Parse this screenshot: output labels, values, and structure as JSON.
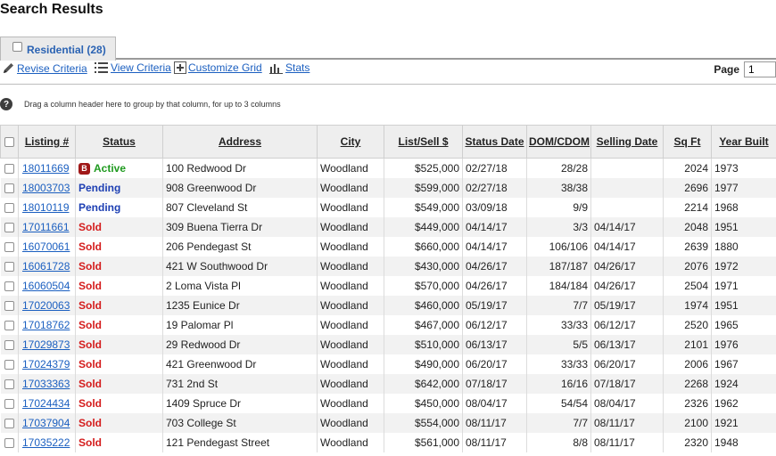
{
  "page": {
    "title": "Search Results"
  },
  "tab": {
    "label": "Residential (28)"
  },
  "toolbar": {
    "revise_label": "Revise Criteria",
    "view_label": "View Criteria",
    "customize_label": "Customize Grid",
    "stats_label": "Stats",
    "page_label": "Page",
    "page_value": "1"
  },
  "hint": {
    "text": "Drag a column header here to group by that column, for up to 3 columns"
  },
  "columns": [
    "Listing #",
    "Status",
    "Address",
    "City",
    "List/Sell $",
    "Status Date",
    "DOM/CDOM",
    "Selling Date",
    "Sq Ft",
    "Year Built"
  ],
  "rows": [
    {
      "listing": "18011669",
      "status": "Active",
      "badge": "B",
      "address": "100 Redwood Dr",
      "city": "Woodland",
      "price": "$525,000",
      "status_date": "02/27/18",
      "dom": "28/28",
      "selling_date": "",
      "sqft": "2024",
      "year": "1973"
    },
    {
      "listing": "18003703",
      "status": "Pending",
      "badge": "",
      "address": "908 Greenwood Dr",
      "city": "Woodland",
      "price": "$599,000",
      "status_date": "02/27/18",
      "dom": "38/38",
      "selling_date": "",
      "sqft": "2696",
      "year": "1977"
    },
    {
      "listing": "18010119",
      "status": "Pending",
      "badge": "",
      "address": "807 Cleveland St",
      "city": "Woodland",
      "price": "$549,000",
      "status_date": "03/09/18",
      "dom": "9/9",
      "selling_date": "",
      "sqft": "2214",
      "year": "1968"
    },
    {
      "listing": "17011661",
      "status": "Sold",
      "badge": "",
      "address": "309 Buena Tierra Dr",
      "city": "Woodland",
      "price": "$449,000",
      "status_date": "04/14/17",
      "dom": "3/3",
      "selling_date": "04/14/17",
      "sqft": "2048",
      "year": "1951"
    },
    {
      "listing": "16070061",
      "status": "Sold",
      "badge": "",
      "address": "206 Pendegast St",
      "city": "Woodland",
      "price": "$660,000",
      "status_date": "04/14/17",
      "dom": "106/106",
      "selling_date": "04/14/17",
      "sqft": "2639",
      "year": "1880"
    },
    {
      "listing": "16061728",
      "status": "Sold",
      "badge": "",
      "address": "421 W Southwood Dr",
      "city": "Woodland",
      "price": "$430,000",
      "status_date": "04/26/17",
      "dom": "187/187",
      "selling_date": "04/26/17",
      "sqft": "2076",
      "year": "1972"
    },
    {
      "listing": "16060504",
      "status": "Sold",
      "badge": "",
      "address": "2 Loma Vista Pl",
      "city": "Woodland",
      "price": "$570,000",
      "status_date": "04/26/17",
      "dom": "184/184",
      "selling_date": "04/26/17",
      "sqft": "2504",
      "year": "1971"
    },
    {
      "listing": "17020063",
      "status": "Sold",
      "badge": "",
      "address": "1235 Eunice Dr",
      "city": "Woodland",
      "price": "$460,000",
      "status_date": "05/19/17",
      "dom": "7/7",
      "selling_date": "05/19/17",
      "sqft": "1974",
      "year": "1951"
    },
    {
      "listing": "17018762",
      "status": "Sold",
      "badge": "",
      "address": "19 Palomar Pl",
      "city": "Woodland",
      "price": "$467,000",
      "status_date": "06/12/17",
      "dom": "33/33",
      "selling_date": "06/12/17",
      "sqft": "2520",
      "year": "1965"
    },
    {
      "listing": "17029873",
      "status": "Sold",
      "badge": "",
      "address": "29 Redwood Dr",
      "city": "Woodland",
      "price": "$510,000",
      "status_date": "06/13/17",
      "dom": "5/5",
      "selling_date": "06/13/17",
      "sqft": "2101",
      "year": "1976"
    },
    {
      "listing": "17024379",
      "status": "Sold",
      "badge": "",
      "address": "421 Greenwood Dr",
      "city": "Woodland",
      "price": "$490,000",
      "status_date": "06/20/17",
      "dom": "33/33",
      "selling_date": "06/20/17",
      "sqft": "2006",
      "year": "1967"
    },
    {
      "listing": "17033363",
      "status": "Sold",
      "badge": "",
      "address": "731 2nd St",
      "city": "Woodland",
      "price": "$642,000",
      "status_date": "07/18/17",
      "dom": "16/16",
      "selling_date": "07/18/17",
      "sqft": "2268",
      "year": "1924"
    },
    {
      "listing": "17024434",
      "status": "Sold",
      "badge": "",
      "address": "1409 Spruce Dr",
      "city": "Woodland",
      "price": "$450,000",
      "status_date": "08/04/17",
      "dom": "54/54",
      "selling_date": "08/04/17",
      "sqft": "2326",
      "year": "1962"
    },
    {
      "listing": "17037904",
      "status": "Sold",
      "badge": "",
      "address": "703 College St",
      "city": "Woodland",
      "price": "$554,000",
      "status_date": "08/11/17",
      "dom": "7/7",
      "selling_date": "08/11/17",
      "sqft": "2100",
      "year": "1921"
    },
    {
      "listing": "17035222",
      "status": "Sold",
      "badge": "",
      "address": "121 Pendegast Street",
      "city": "Woodland",
      "price": "$561,000",
      "status_date": "08/11/17",
      "dom": "8/8",
      "selling_date": "08/11/17",
      "sqft": "2320",
      "year": "1948"
    }
  ],
  "colors": {
    "active": "#1f9a1f",
    "pending": "#1d3fb3",
    "sold": "#d41c1c",
    "link": "#1b5fc0",
    "badge": "#a01818"
  }
}
